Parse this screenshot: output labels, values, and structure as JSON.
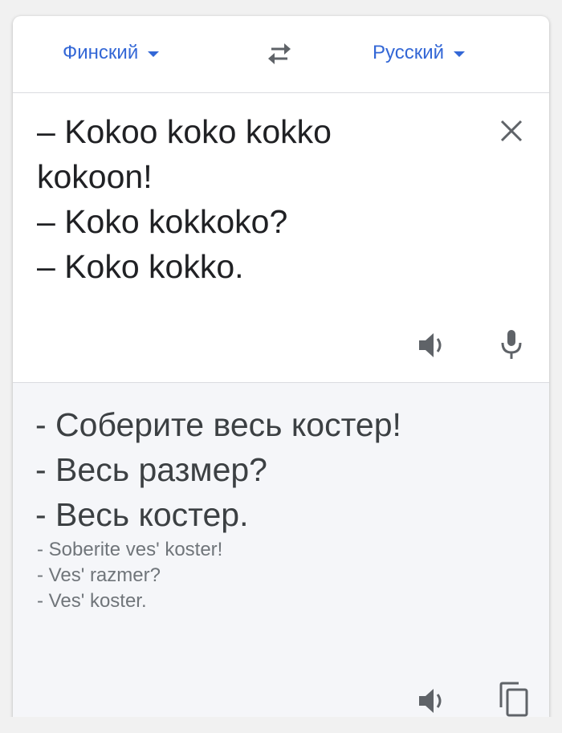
{
  "language_bar": {
    "source_language": "Финский",
    "target_language": "Русский",
    "swap_icon": "swap-arrows-icon"
  },
  "input": {
    "lines": [
      "– Kokoo koko kokko",
      "kokoon!",
      "– Koko kokkoko?",
      "– Koko kokko."
    ],
    "clear_icon": "close-icon",
    "speaker_icon": "speaker-icon",
    "mic_icon": "microphone-icon"
  },
  "output": {
    "translation_lines": [
      "- Соберите весь костер!",
      "- Весь размер?",
      "- Весь костер."
    ],
    "transliteration_lines": [
      "- Soberite ves' koster!",
      "- Ves' razmer?",
      "- Ves' koster."
    ],
    "speaker_icon": "speaker-icon",
    "copy_icon": "copy-icon"
  },
  "colors": {
    "accent": "#3367d6",
    "text_primary": "#202124",
    "text_secondary": "#70757a",
    "output_bg": "#f5f6f9"
  }
}
